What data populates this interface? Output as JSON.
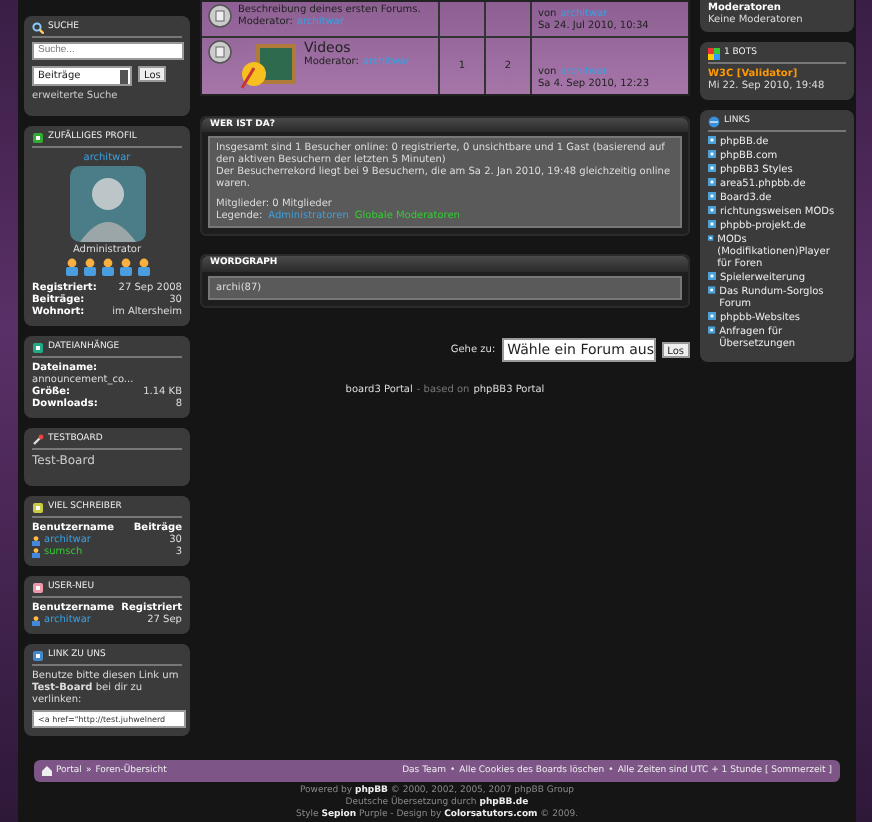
{
  "search": {
    "title": "SUCHE",
    "placeholder": "Suche...",
    "scope": "Beiträge",
    "button": "Los",
    "advanced": "erweiterte Suche"
  },
  "random_profile": {
    "title": "ZUFÄLLIGES PROFIL",
    "username": "architwar",
    "rank": "Administrator",
    "fields": [
      {
        "label": "Registriert:",
        "value": "27 Sep 2008"
      },
      {
        "label": "Beiträge:",
        "value": "30"
      },
      {
        "label": "Wohnort:",
        "value": "im Altersheim"
      }
    ]
  },
  "attachments": {
    "title": "DATEIANHÄNGE",
    "name_label": "Dateiname:",
    "file": "announcement_co...",
    "fields": [
      {
        "label": "Größe:",
        "value": "1.14 KB"
      },
      {
        "label": "Downloads:",
        "value": "8"
      }
    ]
  },
  "testboard": {
    "title": "TESTBOARD",
    "text": "Test-Board"
  },
  "top_posters": {
    "title": "VIEL SCHREIBER",
    "columns": [
      "Benutzername",
      "Beiträge"
    ],
    "rows": [
      {
        "user": "architwar",
        "value": "30",
        "color": "#3aa0e0"
      },
      {
        "user": "sumsch",
        "value": "3",
        "color": "#33cc33"
      }
    ]
  },
  "newest_users": {
    "title": "USER-NEU",
    "columns": [
      "Benutzername",
      "Registriert"
    ],
    "rows": [
      {
        "user": "architwar",
        "value": "27 Sep",
        "color": "#3aa0e0"
      }
    ]
  },
  "link_to_us": {
    "title": "LINK ZU UNS",
    "text": "Benutze bitte diesen Link um **Test-Board** bei dir zu verlinken:",
    "code": "<a href=\"http://test.juhwelnerd"
  },
  "forums": [
    {
      "kind": "forum",
      "description": "Beschreibung deines ersten Forums.",
      "moderator_label": "Moderator:",
      "moderator": "architwar",
      "last_by": "von",
      "last_user": "architwar",
      "last_time": "Sa 24. Jul 2010, 10:34"
    },
    {
      "kind": "videos",
      "name": "Videos",
      "moderator_label": "Moderator:",
      "moderator": "architwar",
      "topics": "1",
      "posts": "2",
      "last_by": "von",
      "last_user": "architwar",
      "last_time": "Sa 4. Sep 2010, 12:23"
    }
  ],
  "who_is_online": {
    "title": "WER IST DA?",
    "lines": [
      "Insgesamt sind 1 Besucher online: 0 registrierte, 0 unsichtbare und 1 Gast (basierend auf den aktiven Besuchern der letzten 5 Minuten)",
      "Der Besucherrekord liegt bei 9 Besuchern, die am Sa 2. Jan 2010, 19:48 gleichzeitig online waren."
    ],
    "members": "Mitglieder: 0 Mitglieder",
    "legend_label": "Legende:",
    "legend": [
      {
        "text": "Administratoren",
        "color": "#3aa0e0"
      },
      {
        "text": "Globale Moderatoren",
        "color": "#33cc33"
      }
    ]
  },
  "wordgraph": {
    "title": "WORDGRAPH",
    "words": "archi(87)"
  },
  "jump": {
    "label": "Gehe zu:",
    "select": "Wähle ein Forum aus",
    "button": "Los"
  },
  "portal_credit": {
    "name": "board3 Portal",
    "middle": "- based on",
    "link": "phpBB3 Portal"
  },
  "moderators": {
    "title": "Moderatoren",
    "text": "Keine Moderatoren"
  },
  "bots": {
    "title": "1 BOTS",
    "name": "W3C [Validator]",
    "time": "Mi 22. Sep 2010, 19:48"
  },
  "links": {
    "title": "LINKS",
    "items": [
      "phpBB.de",
      "phpBB.com",
      "phpBB3 Styles",
      "area51.phpbb.de",
      "Board3.de",
      "richtungsweisen MODs",
      "phpbb-projekt.de",
      "MODs (Modifikationen)Player für Foren",
      "Spielerweiterung",
      "Das Rundum-Sorglos Forum",
      "phpbb-Websites",
      "Anfragen für Übersetzungen"
    ]
  },
  "navbar": {
    "left": [
      "Portal",
      "»",
      "Foren-Übersicht"
    ],
    "right": [
      "Das Team",
      "•",
      "Alle Cookies des Boards löschen",
      "•",
      "Alle Zeiten sind UTC + 1 Stunde [ Sommerzeit ]"
    ]
  },
  "footer": [
    "Powered by **phpBB** © 2000, 2002, 2005, 2007 phpBB Group",
    "Deutsche Übersetzung durch **phpBB.de**",
    "Style **Sepion** Purple - Design by **Colorsatutors.com** © 2009."
  ]
}
